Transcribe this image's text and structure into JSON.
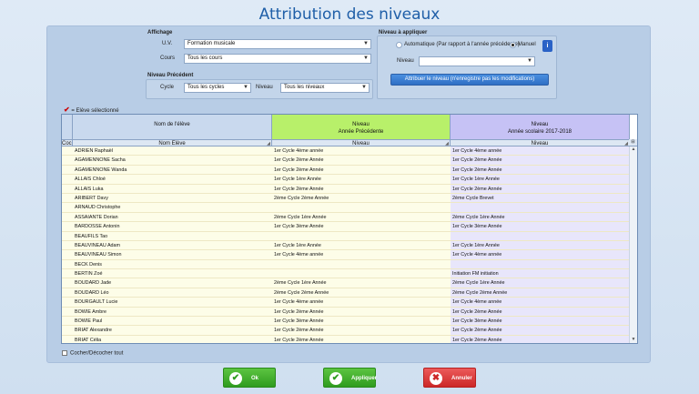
{
  "title": "Attribution des niveaux",
  "affichage": {
    "label": "Affichage",
    "uv_label": "U.V.",
    "uv_value": "Formation musicale",
    "cours_label": "Cours",
    "cours_value": "Tous les cours"
  },
  "niveau_precedent": {
    "label": "Niveau Précédent",
    "cycle_label": "Cycle",
    "cycle_value": "Tous les cycles",
    "niveau_label": "Niveau",
    "niveau_value": "Tous les niveaux"
  },
  "niveau_appliquer": {
    "label": "Niveau à appliquer",
    "auto_label": "Automatique (Par rapport à l'année précédente)",
    "manuel_label": "Manuel",
    "niveau_label": "Niveau",
    "niveau_value": "",
    "button_label": "Attribuer le niveau (n'enregistre pas les modifications)"
  },
  "legend": "= Elève sélectionné",
  "grid": {
    "col0_header": "Coc",
    "nom_header": "Nom de l'élève",
    "prev_header_line1": "Niveau",
    "prev_header_line2": "Année Précédente",
    "curr_header_line1": "Niveau",
    "curr_header_line2": "Année scolaire 2017-2018",
    "nom_sub": "Nom Elève",
    "prev_sub": "Niveau",
    "curr_sub": "Niveau",
    "rows": [
      {
        "nom": "ADRIEN Raphaël",
        "prev": "1er Cycle 4ème année",
        "curr": "1er Cycle 4ème année"
      },
      {
        "nom": "AGAMENNONE Sacha",
        "prev": "1er Cycle 2ème Année",
        "curr": "1er Cycle 2ème Année"
      },
      {
        "nom": "AGAMENNONE Wanda",
        "prev": "1er Cycle 2ème Année",
        "curr": "1er Cycle 2ème Année"
      },
      {
        "nom": "ALLAIS Chloé",
        "prev": "1er Cycle 1ère Année",
        "curr": "1er Cycle 1ère Année"
      },
      {
        "nom": "ALLAIS Luka",
        "prev": "1er Cycle 2ème Année",
        "curr": "1er Cycle 2ème Année"
      },
      {
        "nom": "ARIBERT Davy",
        "prev": "2ème Cycle 2ème Année",
        "curr": "2ème Cycle Brevet"
      },
      {
        "nom": "ARNAUD Christophe",
        "prev": "",
        "curr": ""
      },
      {
        "nom": "ASSAIANTE Dorian",
        "prev": "2ème Cycle 1ère Année",
        "curr": "2ème Cycle 1ère Année"
      },
      {
        "nom": "BARDOSSE Antonin",
        "prev": "1er Cycle 3ème Année",
        "curr": "1er Cycle 3ème Année"
      },
      {
        "nom": "BEAUFILS Tao",
        "prev": "",
        "curr": ""
      },
      {
        "nom": "BEAUVINEAU Adam",
        "prev": "1er Cycle 1ère Année",
        "curr": "1er Cycle 1ère Année"
      },
      {
        "nom": "BEAUVINEAU Simon",
        "prev": "1er Cycle 4ème année",
        "curr": "1er Cycle 4ème année"
      },
      {
        "nom": "BECK Denis",
        "prev": "",
        "curr": ""
      },
      {
        "nom": "BERTIN Zoé",
        "prev": "",
        "curr": "Initiation FM initiation"
      },
      {
        "nom": "BOUDARD Jade",
        "prev": "2ème Cycle 1ère Année",
        "curr": "2ème Cycle 1ère Année"
      },
      {
        "nom": "BOUDARD Léo",
        "prev": "2ème Cycle 2ème Année",
        "curr": "2ème Cycle 2ème Année"
      },
      {
        "nom": "BOURGAULT Lucie",
        "prev": "1er Cycle 4ème année",
        "curr": "1er Cycle 4ème année"
      },
      {
        "nom": "BOWIE Ambre",
        "prev": "1er Cycle 2ème Année",
        "curr": "1er Cycle 2ème Année"
      },
      {
        "nom": "BOWIE Paul",
        "prev": "1er Cycle 3ème Année",
        "curr": "1er Cycle 3ème Année"
      },
      {
        "nom": "BRIAT Alexandre",
        "prev": "1er Cycle 2ème Année",
        "curr": "1er Cycle 2ème Année"
      },
      {
        "nom": "BRIAT Célia",
        "prev": "1er Cycle 2ème Année",
        "curr": "1er Cycle 2ème Année"
      }
    ]
  },
  "cocher_label": "Cocher/Décocher tout",
  "buttons": {
    "ok": "Ok",
    "appliquer": "Appliquer",
    "annuler": "Annuler"
  },
  "colors": {
    "title": "#1f5fa8",
    "row_yellow": "#fdfde8",
    "prev_header": "#b8f06a",
    "curr_header": "#c6c2f5",
    "curr_col_bg": "#e8e6fb"
  }
}
